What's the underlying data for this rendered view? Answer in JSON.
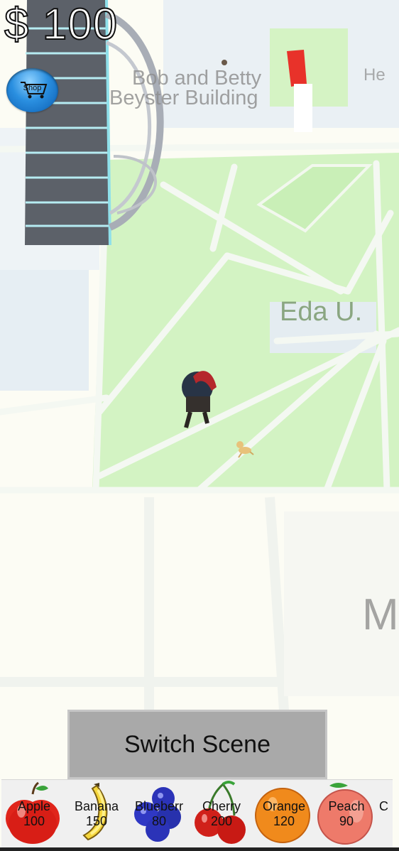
{
  "hud": {
    "money": "$ 100",
    "shop_label": "Shop"
  },
  "map": {
    "labels": {
      "building1": "Bob and Betty",
      "building2": "Beyster Building",
      "building_right": "He",
      "eda": "Eda U.",
      "edge_letter": "M"
    }
  },
  "switch_button": {
    "label": "Switch Scene"
  },
  "fruit_tray": {
    "items": [
      {
        "name": "Apple",
        "price": "100",
        "icon": "apple-icon",
        "color": "#e0251b"
      },
      {
        "name": "Banana",
        "price": "150",
        "icon": "banana-icon",
        "color": "#f2d23a"
      },
      {
        "name": "Blueberr",
        "price": "80",
        "icon": "blueberry-icon",
        "color": "#2b33b8"
      },
      {
        "name": "Cherry",
        "price": "200",
        "icon": "cherry-icon",
        "color": "#d0201a"
      },
      {
        "name": "Orange",
        "price": "120",
        "icon": "orange-icon",
        "color": "#f08a1c"
      },
      {
        "name": "Peach",
        "price": "90",
        "icon": "peach-icon",
        "color": "#ee7a6a"
      },
      {
        "name": "C",
        "price": "",
        "icon": "partial-fruit-icon",
        "color": "#f0f0f0"
      }
    ]
  }
}
